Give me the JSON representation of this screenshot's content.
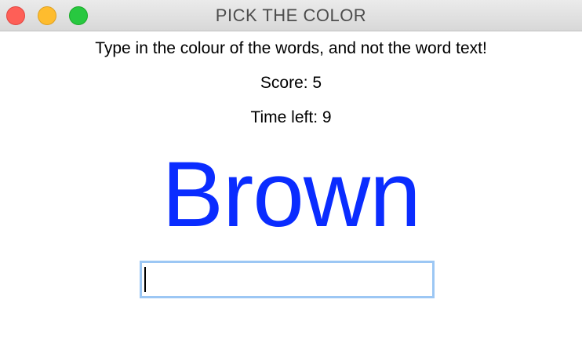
{
  "window": {
    "title": "PICK THE COLOR"
  },
  "game": {
    "instructions": "Type in the colour of the words, and not the word text!",
    "score_text": "Score: 5",
    "time_left_text": "Time left: 9",
    "color_word": "Brown",
    "color_word_color": "#0a2cff"
  },
  "answer": {
    "value": "",
    "placeholder": ""
  },
  "colors": {
    "close": "#fe5f57",
    "minimize": "#febc2e",
    "maximize": "#28c840",
    "input_focus_ring": "#9cc7f4"
  }
}
